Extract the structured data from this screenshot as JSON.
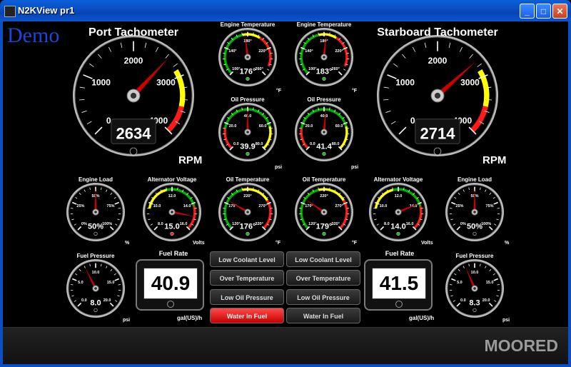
{
  "window": {
    "title": "N2KView pr1",
    "min": "_",
    "max": "□",
    "close": "✕"
  },
  "brand": "Demo",
  "status": "MOORED",
  "colors": {
    "accent": "#0a5fd8",
    "needle": "#cc0000",
    "red": "#ff1a1a",
    "yellow": "#ffff00",
    "green": "#00b000"
  },
  "tachometers": [
    {
      "id": "port",
      "title": "Port Tachometer",
      "value": "2634",
      "unit": "RPM",
      "ticks": [
        "0",
        "1000",
        "2000",
        "3000",
        "4000"
      ],
      "min": 0,
      "max": 4000,
      "reading": 2634
    },
    {
      "id": "starboard",
      "title": "Starboard Tachometer",
      "value": "2714",
      "unit": "RPM",
      "ticks": [
        "0",
        "1000",
        "2000",
        "3000",
        "4000"
      ],
      "min": 0,
      "max": 4000,
      "reading": 2714
    }
  ],
  "gauges": [
    {
      "id": "eng-temp-1",
      "title": "Engine Temperature",
      "value": "176°",
      "unit": "°F",
      "ticks": [
        "100°",
        "140°",
        "180°",
        "220°",
        "260°"
      ],
      "min": 100,
      "max": 260,
      "reading": 176,
      "bands": "temp",
      "knob": "green"
    },
    {
      "id": "eng-temp-2",
      "title": "Engine Temperature",
      "value": "183°",
      "unit": "°F",
      "ticks": [
        "100°",
        "140°",
        "180°",
        "220°",
        "260°"
      ],
      "min": 100,
      "max": 260,
      "reading": 183,
      "bands": "temp",
      "knob": "green"
    },
    {
      "id": "oil-p-1",
      "title": "Oil Pressure",
      "value": "39.9",
      "unit": "psi",
      "ticks": [
        "0.0",
        "20.0",
        "40.0",
        "60.0",
        "80.0"
      ],
      "min": 0,
      "max": 80,
      "reading": 39.9,
      "bands": "oilp",
      "knob": "green"
    },
    {
      "id": "oil-p-2",
      "title": "Oil Pressure",
      "value": "41.4",
      "unit": "psi",
      "ticks": [
        "0.0",
        "20.0",
        "40.0",
        "60.0",
        "80.0"
      ],
      "min": 0,
      "max": 80,
      "reading": 41.4,
      "bands": "oilp",
      "knob": "green"
    },
    {
      "id": "eng-load-1",
      "title": "Engine Load",
      "value": "50%",
      "unit": "%",
      "ticks": [
        "0%",
        "25%",
        "50%",
        "75%",
        "100%"
      ],
      "min": 0,
      "max": 100,
      "reading": 50,
      "bands": "none",
      "knob": "off"
    },
    {
      "id": "alt-v-1",
      "title": "Alternator Voltage",
      "value": "15.0",
      "unit": "Volts",
      "ticks": [
        "8.0",
        "10.0",
        "12.0",
        "14.0",
        "16.0"
      ],
      "min": 8,
      "max": 16,
      "reading": 15.0,
      "bands": "volt",
      "knob": "red"
    },
    {
      "id": "oil-t-1",
      "title": "Oil Temperature",
      "value": "176°",
      "unit": "°F",
      "ticks": [
        "120°",
        "170°",
        "220°",
        "270°",
        "320°"
      ],
      "min": 120,
      "max": 320,
      "reading": 176,
      "bands": "oilt",
      "knob": "green"
    },
    {
      "id": "oil-t-2",
      "title": "Oil Temperature",
      "value": "179°",
      "unit": "°F",
      "ticks": [
        "120°",
        "170°",
        "220°",
        "270°",
        "320°"
      ],
      "min": 120,
      "max": 320,
      "reading": 179,
      "bands": "oilt",
      "knob": "green"
    },
    {
      "id": "alt-v-2",
      "title": "Alternator Voltage",
      "value": "14.0",
      "unit": "Volts",
      "ticks": [
        "8.0",
        "10.0",
        "12.0",
        "14.0",
        "16.0"
      ],
      "min": 8,
      "max": 16,
      "reading": 14.0,
      "bands": "volt",
      "knob": "green"
    },
    {
      "id": "eng-load-2",
      "title": "Engine Load",
      "value": "50%",
      "unit": "%",
      "ticks": [
        "0%",
        "25%",
        "50%",
        "75%",
        "100%"
      ],
      "min": 0,
      "max": 100,
      "reading": 50,
      "bands": "none",
      "knob": "off"
    },
    {
      "id": "fuel-p-1",
      "title": "Fuel Pressure",
      "value": "8.0",
      "unit": "psi",
      "ticks": [
        "0.0",
        "5.0",
        "10.0",
        "15.0",
        "20.0"
      ],
      "min": 0,
      "max": 20,
      "reading": 8.0,
      "bands": "none",
      "knob": "off"
    },
    {
      "id": "fuel-p-2",
      "title": "Fuel Pressure",
      "value": "8.3",
      "unit": "psi",
      "ticks": [
        "0.0",
        "5.0",
        "10.0",
        "15.0",
        "20.0"
      ],
      "min": 0,
      "max": 20,
      "reading": 8.3,
      "bands": "none",
      "knob": "off"
    }
  ],
  "fuel_rates": [
    {
      "title": "Fuel Rate",
      "value": "40.9",
      "unit": "gal(US)/h"
    },
    {
      "title": "Fuel Rate",
      "value": "41.5",
      "unit": "gal(US)/h"
    }
  ],
  "alarms": [
    {
      "label": "Low Coolant Level",
      "active": false
    },
    {
      "label": "Low Coolant Level",
      "active": false
    },
    {
      "label": "Over Temperature",
      "active": false
    },
    {
      "label": "Over Temperature",
      "active": false
    },
    {
      "label": "Low Oil Pressure",
      "active": false
    },
    {
      "label": "Low Oil Pressure",
      "active": false
    },
    {
      "label": "Water In Fuel",
      "active": true
    },
    {
      "label": "Water In Fuel",
      "active": false
    }
  ]
}
